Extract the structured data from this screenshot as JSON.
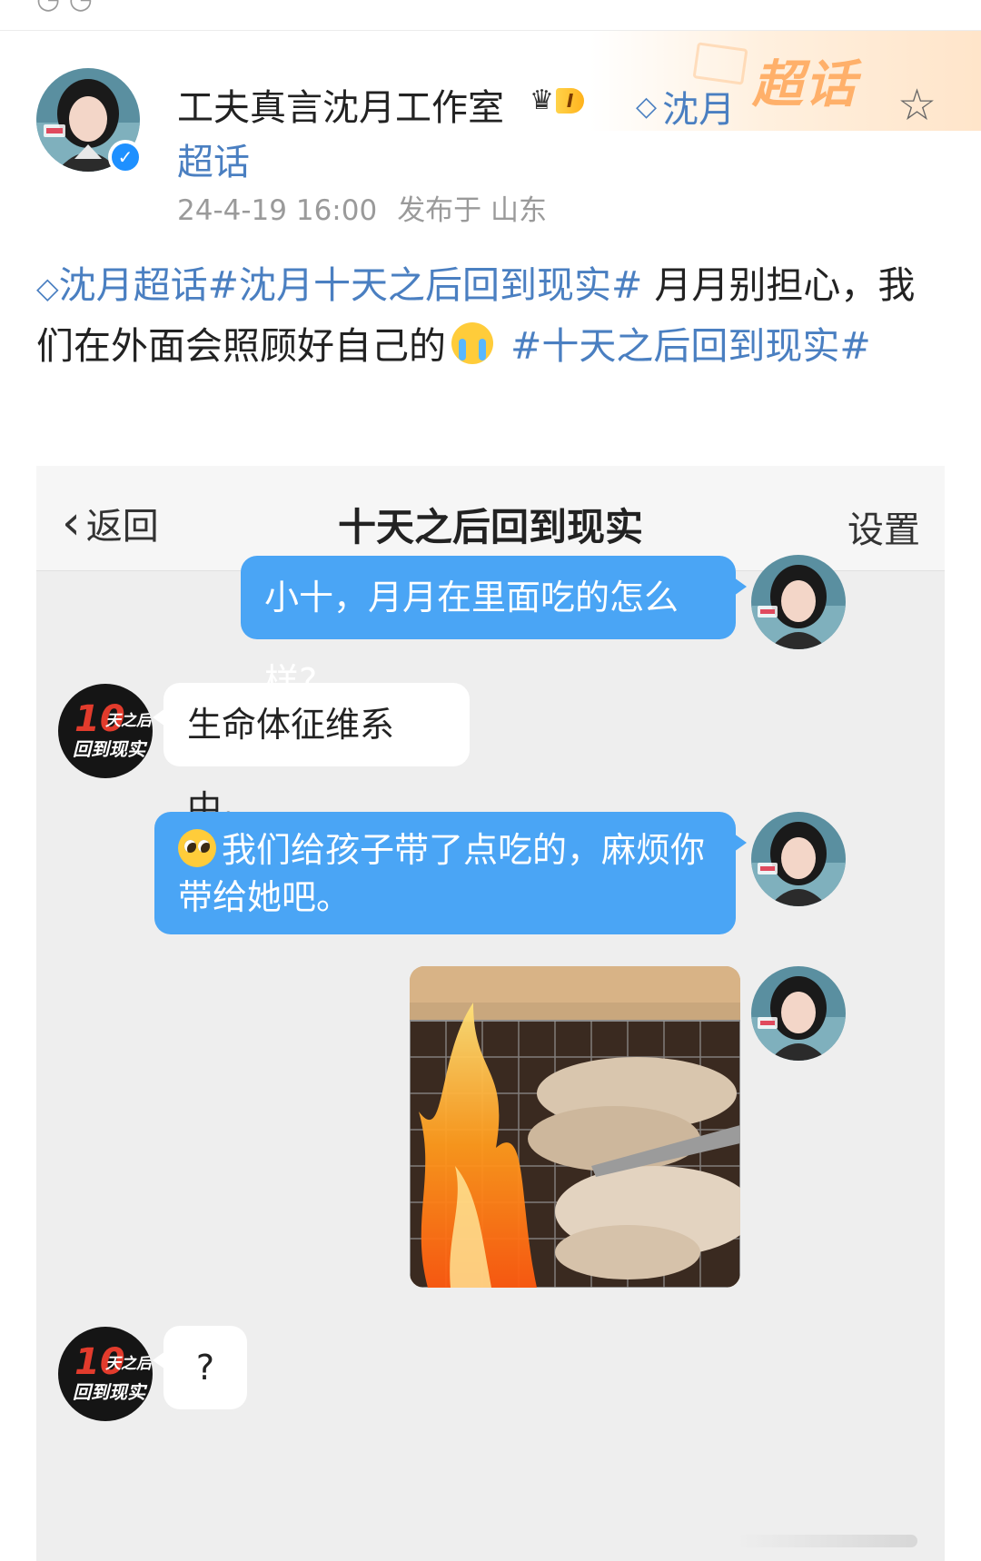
{
  "post": {
    "username": "工夫真言沈月工作室",
    "level_badge": "I",
    "supertopic_link": "沈月",
    "supertopic_link_2": "超话",
    "deco_label": "超话",
    "timestamp": "24-4-19 16:00",
    "location": "发布于 山东",
    "content": {
      "tag1": "沈月超话#沈月十天之后回到现实#",
      "text1": " 月月别担心，我们在外面会照顾好自己的",
      "tag2": " #十天之后回到现实#"
    }
  },
  "chat": {
    "back_label": "返回",
    "title": "十天之后回到现实",
    "settings_label": "设置",
    "show_avatar": {
      "number": "10",
      "line1": "天之后",
      "line2": "回到现实"
    },
    "messages": [
      {
        "from": "me",
        "text": "小十，月月在里面吃的怎么样?"
      },
      {
        "from": "other",
        "text": "生命体征维系中。"
      },
      {
        "from": "me",
        "text": "我们给孩子带了点吃的，麻烦你带给她吧。"
      },
      {
        "from": "me",
        "type": "image"
      },
      {
        "from": "other",
        "text": "?"
      }
    ]
  },
  "colors": {
    "link": "#4a7fc1",
    "my_bubble": "#4aa5f5",
    "other_bubble": "#ffffff",
    "chat_bg": "#eeeeee",
    "verified": "#1e90ff"
  },
  "icons": [
    "verified-icon",
    "crown-icon",
    "supertopic-diamond-icon",
    "star-icon",
    "back-chevron-icon",
    "crying-emoji",
    "pleading-emoji"
  ]
}
